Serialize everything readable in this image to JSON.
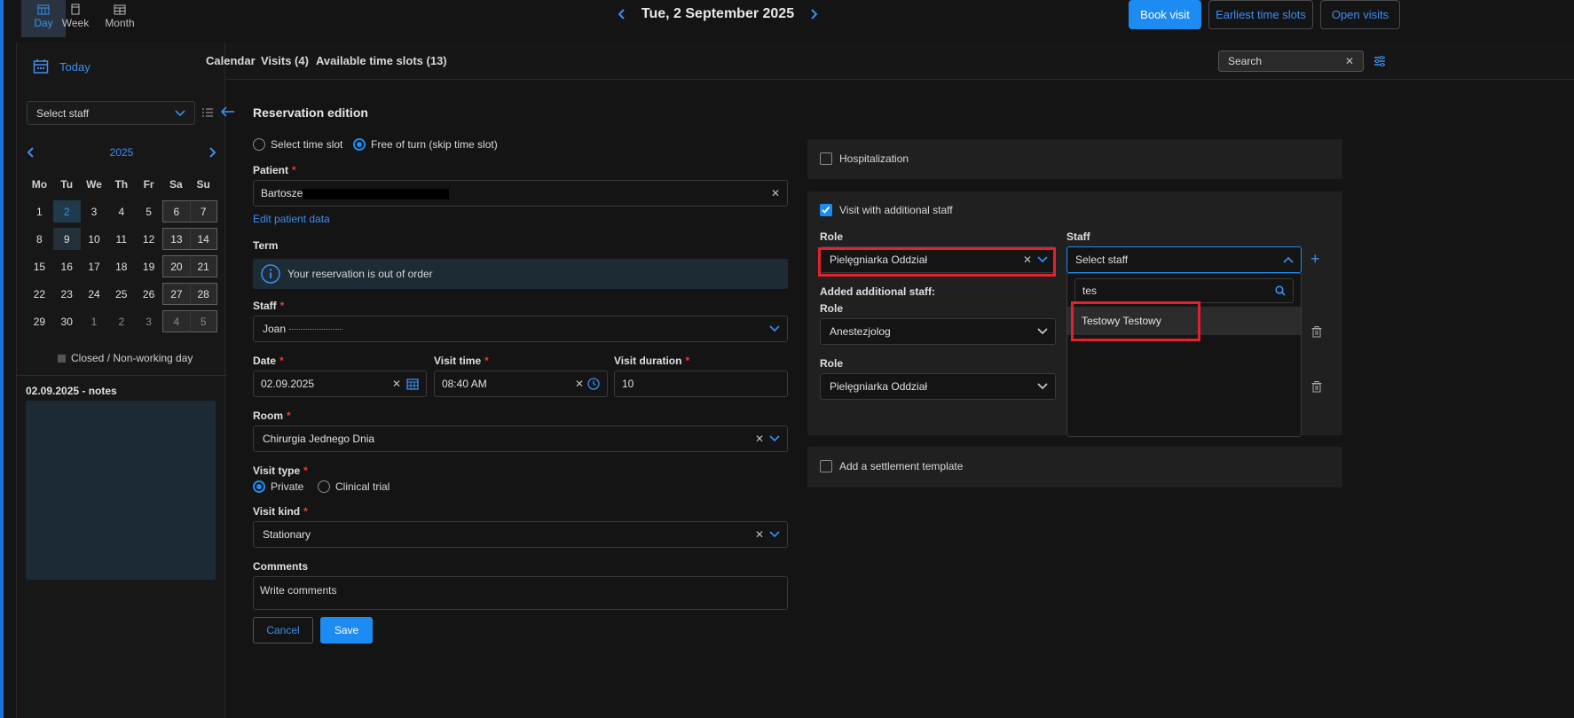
{
  "topbar": {
    "views": [
      {
        "label": "Day",
        "icon": "calendar-day-icon",
        "active": true
      },
      {
        "label": "Week",
        "icon": "calendar-week-icon",
        "active": false
      },
      {
        "label": "Month",
        "icon": "calendar-month-icon",
        "active": false
      }
    ],
    "date_label": "Tue, 2 September 2025",
    "book_visit": "Book visit",
    "earliest_slots": "Earliest time slots",
    "open_visits": "Open visits"
  },
  "sidebar": {
    "today": "Today",
    "select_staff": "Select staff",
    "year": "2025",
    "weekdays": [
      "Mo",
      "Tu",
      "We",
      "Th",
      "Fr",
      "Sa",
      "Su"
    ],
    "weeks": [
      [
        "1",
        "2",
        "3",
        "4",
        "5",
        "6",
        "7"
      ],
      [
        "8",
        "9",
        "10",
        "11",
        "12",
        "13",
        "14"
      ],
      [
        "15",
        "16",
        "17",
        "18",
        "19",
        "20",
        "21"
      ],
      [
        "22",
        "23",
        "24",
        "25",
        "26",
        "27",
        "28"
      ],
      [
        "29",
        "30",
        "1",
        "2",
        "3",
        "4",
        "5"
      ]
    ],
    "closed_legend": "Closed / Non-working day",
    "notes_title": "02.09.2025 - notes"
  },
  "tabs": {
    "calendar": "Calendar",
    "visits": "Visits (4)",
    "slots": "Available time slots (13)",
    "search_placeholder": "Search"
  },
  "form": {
    "title": "Reservation edition",
    "opt_select_slot": "Select time slot",
    "opt_free_turn": "Free of turn (skip time slot)",
    "patient_label": "Patient",
    "patient_value": "Bartosze",
    "edit_patient": "Edit patient data",
    "term_label": "Term",
    "info_text": "Your reservation is out of order",
    "staff_label": "Staff",
    "staff_value": "Joan",
    "date_label": "Date",
    "date_value": "02.09.2025",
    "time_label": "Visit time",
    "time_value": "08:40 AM",
    "duration_label": "Visit duration",
    "duration_value": "10",
    "room_label": "Room",
    "room_value": "Chirurgia Jednego Dnia",
    "visit_type_label": "Visit type",
    "type_private": "Private",
    "type_clinical": "Clinical trial",
    "visit_kind_label": "Visit kind",
    "visit_kind_value": "Stationary",
    "comments_label": "Comments",
    "comments_placeholder": "Write comments",
    "cancel": "Cancel",
    "save": "Save"
  },
  "right": {
    "hospitalization": "Hospitalization",
    "additional_staff": "Visit with additional staff",
    "role_label": "Role",
    "staff_label": "Staff",
    "role_value": "Pielęgniarka Oddział",
    "staff_placeholder": "Select staff",
    "added_label": "Added additional staff:",
    "added": [
      {
        "role_label": "Role",
        "role": "Anestezjolog"
      },
      {
        "role_label": "Role",
        "role": "Pielęgniarka Oddział"
      }
    ],
    "dropdown_search": "tes",
    "dropdown_option": "Testowy Testowy",
    "settlement": "Add a settlement template"
  },
  "colors": {
    "accent": "#1c8cf2",
    "highlight": "#e3222f"
  }
}
